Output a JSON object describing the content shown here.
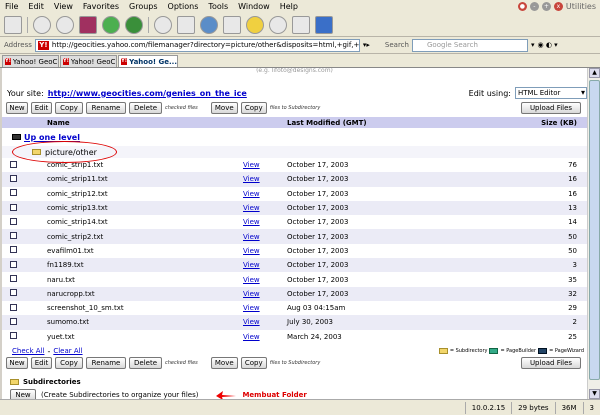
{
  "menu": [
    "File",
    "Edit",
    "View",
    "Favorites",
    "Groups",
    "Options",
    "Tools",
    "Window",
    "Help"
  ],
  "utilities_label": "Utilities",
  "address": {
    "label": "Address",
    "url": "http://geocities.yahoo.com/filemanager?directory=picture/other&disposits=html,+gif,+jpg,+other%"
  },
  "search": {
    "label": "Search",
    "placeholder": "Google Search"
  },
  "tabs": [
    {
      "label": "Yahoo! GeoCi..."
    },
    {
      "label": "Yahoo! GeoCi..."
    },
    {
      "label": "Yahoo! Ge..."
    }
  ],
  "page": {
    "top_fragment": "(e.g. lifoto@designs.com)",
    "site_label": "Your site:",
    "site_url": "http://www.geocities.com/genies_on_the_ice",
    "edit_using_label": "Edit using:",
    "edit_using_value": "HTML Editor",
    "btn_new": "New",
    "btn_edit": "Edit",
    "btn_copy": "Copy",
    "btn_rename": "Rename",
    "btn_delete": "Delete",
    "checked_files": "checked files",
    "btn_move": "Move",
    "btn_copy2": "Copy",
    "files_to_sub": "files to Subdirectory",
    "btn_upload": "Upload Files",
    "col_name": "Name",
    "col_modified": "Last Modified (GMT)",
    "col_size": "Size (KB)",
    "up_one_level": "Up one level",
    "current_dir": "picture/other",
    "check_all": "Check All",
    "clear_all": "Clear All",
    "legend_sub": "= Subdirectory",
    "legend_pb": "= PageBuilder",
    "legend_pw": "= PageWizard",
    "subdirectories": "Subdirectories",
    "btn_new2": "New",
    "create_hint": "(Create Subdirectories to organize your files)",
    "annotation": "Membuat Folder"
  },
  "files": [
    {
      "name": "comic_strip1.txt",
      "view": "View",
      "date": "October 17, 2003",
      "size": "76"
    },
    {
      "name": "comic_strip11.txt",
      "view": "View",
      "date": "October 17, 2003",
      "size": "16"
    },
    {
      "name": "comic_strip12.txt",
      "view": "View",
      "date": "October 17, 2003",
      "size": "16"
    },
    {
      "name": "comic_strip13.txt",
      "view": "View",
      "date": "October 17, 2003",
      "size": "13"
    },
    {
      "name": "comic_strip14.txt",
      "view": "View",
      "date": "October 17, 2003",
      "size": "14"
    },
    {
      "name": "comic_strip2.txt",
      "view": "View",
      "date": "October 17, 2003",
      "size": "50"
    },
    {
      "name": "evafilm01.txt",
      "view": "View",
      "date": "October 17, 2003",
      "size": "50"
    },
    {
      "name": "fn1189.txt",
      "view": "View",
      "date": "October 17, 2003",
      "size": "3"
    },
    {
      "name": "naru.txt",
      "view": "View",
      "date": "October 17, 2003",
      "size": "35"
    },
    {
      "name": "narucropp.txt",
      "view": "View",
      "date": "October 17, 2003",
      "size": "32"
    },
    {
      "name": "screenshot_10_sm.txt",
      "view": "View",
      "date": "Aug 03 04:15am",
      "size": "29"
    },
    {
      "name": "sumomo.txt",
      "view": "View",
      "date": "July 30, 2003",
      "size": "2"
    },
    {
      "name": "yuet.txt",
      "view": "View",
      "date": "March 24, 2003",
      "size": "25"
    }
  ],
  "status": {
    "ip": "10.0.2.15",
    "bytes": "29 bytes",
    "mem": "36M",
    "num": "3"
  }
}
